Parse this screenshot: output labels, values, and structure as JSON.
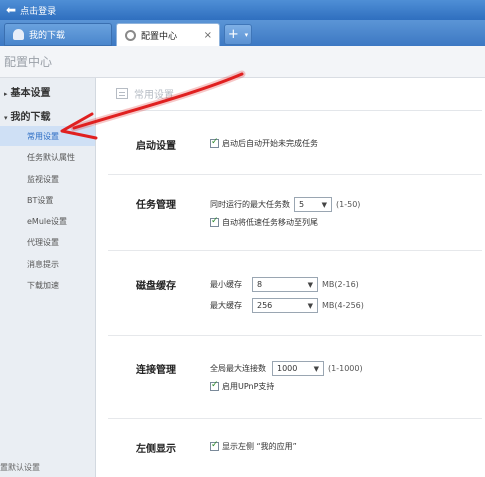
{
  "topbar": {
    "login_text": "点击登录"
  },
  "tabs": [
    {
      "label": "我的下载",
      "icon": "user-icon"
    },
    {
      "label": "配置中心",
      "icon": "gear-icon",
      "close": "×"
    }
  ],
  "new_tab": {
    "plus": "+",
    "dropdown": "▾"
  },
  "page_title": "配置中心",
  "sidebar": {
    "sections": [
      {
        "label": "基本设置",
        "toggle": "▸"
      },
      {
        "label": "我的下载",
        "toggle": "▾"
      }
    ],
    "items": [
      {
        "label": "常用设置",
        "active": true
      },
      {
        "label": "任务默认属性"
      },
      {
        "label": "监视设置"
      },
      {
        "label": "BT设置"
      },
      {
        "label": "eMule设置"
      },
      {
        "label": "代理设置"
      },
      {
        "label": "消息提示"
      },
      {
        "label": "下载加速"
      }
    ],
    "bottom_text": "置默认设置"
  },
  "main": {
    "section_title": "常用设置",
    "startup": {
      "label": "启动设置",
      "auto_start": {
        "text": "启动后自动开始未完成任务",
        "checked": true
      }
    },
    "task_mgmt": {
      "label": "任务管理",
      "max_tasks_label": "同时运行的最大任务数",
      "max_tasks_value": "5",
      "max_tasks_range": "(1-50)",
      "move_slow": {
        "text": "自动将低速任务移动至列尾",
        "checked": true
      }
    },
    "disk_cache": {
      "label": "磁盘缓存",
      "min_label": "最小缓存",
      "min_value": "8",
      "min_range": "MB(2-16)",
      "max_label": "最大缓存",
      "max_value": "256",
      "max_range": "MB(4-256)"
    },
    "connection": {
      "label": "连接管理",
      "max_conn_label": "全局最大连接数",
      "max_conn_value": "1000",
      "max_conn_range": "(1-1000)",
      "upnp": {
        "text": "启用UPnP支持",
        "checked": true
      }
    },
    "left_display": {
      "label": "左侧显示",
      "show_apps": {
        "text": "显示左侧 “我的应用”",
        "checked": true
      }
    }
  },
  "annotation_color": "#e02020"
}
